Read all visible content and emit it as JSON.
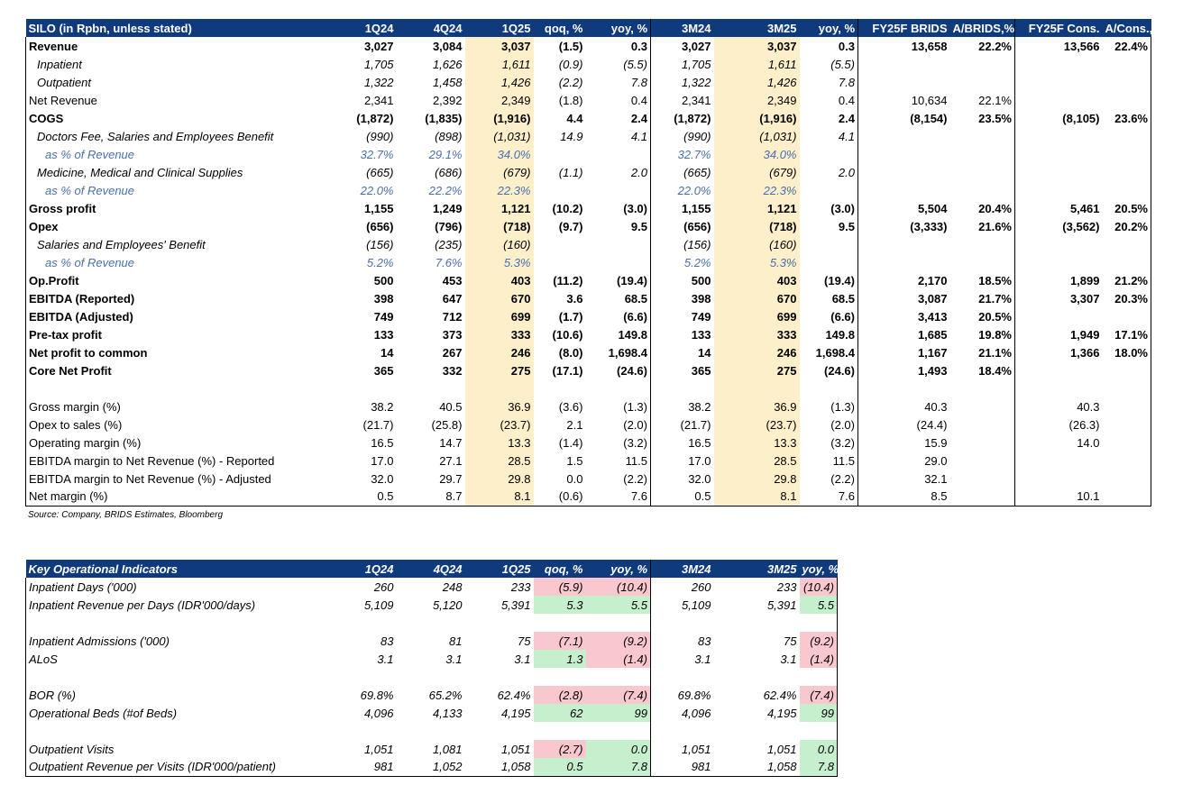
{
  "financials": {
    "header": [
      "SILO (in Rpbn, unless stated)",
      "1Q24",
      "4Q24",
      "1Q25",
      "qoq, %",
      "yoy, %",
      "3M24",
      "3M25",
      "yoy, %",
      "FY25F BRIDS",
      "A/BRIDS,%",
      "FY25F Cons.",
      "A/Cons.,%"
    ],
    "rows": [
      {
        "s": "b",
        "c": [
          "Revenue",
          "3,027",
          "3,084",
          "3,037",
          "(1.5)",
          "0.3",
          "3,027",
          "3,037",
          "0.3",
          "13,658",
          "22.2%",
          "13,566",
          "22.4%"
        ]
      },
      {
        "s": "i",
        "c": [
          "Inpatient",
          "1,705",
          "1,626",
          "1,611",
          "(0.9)",
          "(5.5)",
          "1,705",
          "1,611",
          "(5.5)",
          "",
          "",
          "",
          ""
        ]
      },
      {
        "s": "i",
        "c": [
          "Outpatient",
          "1,322",
          "1,458",
          "1,426",
          "(2.2)",
          "7.8",
          "1,322",
          "1,426",
          "7.8",
          "",
          "",
          "",
          ""
        ]
      },
      {
        "s": "ni",
        "c": [
          "Net Revenue",
          "2,341",
          "2,392",
          "2,349",
          "(1.8)",
          "0.4",
          "2,341",
          "2,349",
          "0.4",
          "10,634",
          "22.1%",
          "",
          ""
        ]
      },
      {
        "s": "b",
        "c": [
          "COGS",
          "(1,872)",
          "(1,835)",
          "(1,916)",
          "4.4",
          "2.4",
          "(1,872)",
          "(1,916)",
          "2.4",
          "(8,154)",
          "23.5%",
          "(8,105)",
          "23.6%"
        ]
      },
      {
        "s": "i",
        "c": [
          "Doctors Fee, Salaries and Employees Benefit",
          "(990)",
          "(898)",
          "(1,031)",
          "14.9",
          "4.1",
          "(990)",
          "(1,031)",
          "4.1",
          "",
          "",
          "",
          ""
        ]
      },
      {
        "s": "p",
        "c": [
          "as % of Revenue",
          "32.7%",
          "29.1%",
          "34.0%",
          "",
          "",
          "32.7%",
          "34.0%",
          "",
          "",
          "",
          "",
          ""
        ]
      },
      {
        "s": "i",
        "c": [
          "Medicine, Medical and Clinical Supplies",
          "(665)",
          "(686)",
          "(679)",
          "(1.1)",
          "2.0",
          "(665)",
          "(679)",
          "2.0",
          "",
          "",
          "",
          ""
        ]
      },
      {
        "s": "p",
        "c": [
          "as % of Revenue",
          "22.0%",
          "22.2%",
          "22.3%",
          "",
          "",
          "22.0%",
          "22.3%",
          "",
          "",
          "",
          "",
          ""
        ]
      },
      {
        "s": "b",
        "c": [
          "Gross profit",
          "1,155",
          "1,249",
          "1,121",
          "(10.2)",
          "(3.0)",
          "1,155",
          "1,121",
          "(3.0)",
          "5,504",
          "20.4%",
          "5,461",
          "20.5%"
        ]
      },
      {
        "s": "b",
        "c": [
          "Opex",
          "(656)",
          "(796)",
          "(718)",
          "(9.7)",
          "9.5",
          "(656)",
          "(718)",
          "9.5",
          "(3,333)",
          "21.6%",
          "(3,562)",
          "20.2%"
        ]
      },
      {
        "s": "i",
        "c": [
          "Salaries and Employees' Benefit",
          "(156)",
          "(235)",
          "(160)",
          "",
          "",
          "(156)",
          "(160)",
          "",
          "",
          "",
          "",
          ""
        ]
      },
      {
        "s": "p",
        "c": [
          "as % of Revenue",
          "5.2%",
          "7.6%",
          "5.3%",
          "",
          "",
          "5.2%",
          "5.3%",
          "",
          "",
          "",
          "",
          ""
        ]
      },
      {
        "s": "b",
        "c": [
          "Op.Profit",
          "500",
          "453",
          "403",
          "(11.2)",
          "(19.4)",
          "500",
          "403",
          "(19.4)",
          "2,170",
          "18.5%",
          "1,899",
          "21.2%"
        ]
      },
      {
        "s": "b",
        "c": [
          "EBITDA (Reported)",
          "398",
          "647",
          "670",
          "3.6",
          "68.5",
          "398",
          "670",
          "68.5",
          "3,087",
          "21.7%",
          "3,307",
          "20.3%"
        ]
      },
      {
        "s": "b",
        "c": [
          "EBITDA (Adjusted)",
          "749",
          "712",
          "699",
          "(1.7)",
          "(6.6)",
          "749",
          "699",
          "(6.6)",
          "3,413",
          "20.5%",
          "",
          ""
        ]
      },
      {
        "s": "b",
        "c": [
          "Pre-tax profit",
          "133",
          "373",
          "333",
          "(10.6)",
          "149.8",
          "133",
          "333",
          "149.8",
          "1,685",
          "19.8%",
          "1,949",
          "17.1%"
        ]
      },
      {
        "s": "b",
        "c": [
          "Net profit to common",
          "14",
          "267",
          "246",
          "(8.0)",
          "1,698.4",
          "14",
          "246",
          "1,698.4",
          "1,167",
          "21.1%",
          "1,366",
          "18.0%"
        ]
      },
      {
        "s": "b",
        "c": [
          "Core Net Profit",
          "365",
          "332",
          "275",
          "(17.1)",
          "(24.6)",
          "365",
          "275",
          "(24.6)",
          "1,493",
          "18.4%",
          "",
          ""
        ]
      },
      {
        "s": "blank",
        "c": [
          "",
          "",
          "",
          "",
          "",
          "",
          "",
          "",
          "",
          "",
          "",
          "",
          ""
        ]
      },
      {
        "s": "n",
        "c": [
          "Gross margin (%)",
          "38.2",
          "40.5",
          "36.9",
          "(3.6)",
          "(1.3)",
          "38.2",
          "36.9",
          "(1.3)",
          "40.3",
          "",
          "40.3",
          ""
        ]
      },
      {
        "s": "n",
        "c": [
          "Opex to sales (%)",
          "(21.7)",
          "(25.8)",
          "(23.7)",
          "2.1",
          "(2.0)",
          "(21.7)",
          "(23.7)",
          "(2.0)",
          "(24.4)",
          "",
          "(26.3)",
          ""
        ]
      },
      {
        "s": "n",
        "c": [
          "Operating margin (%)",
          "16.5",
          "14.7",
          "13.3",
          "(1.4)",
          "(3.2)",
          "16.5",
          "13.3",
          "(3.2)",
          "15.9",
          "",
          "14.0",
          ""
        ]
      },
      {
        "s": "n",
        "c": [
          "EBITDA margin to Net Revenue (%) - Reported",
          "17.0",
          "27.1",
          "28.5",
          "1.5",
          "11.5",
          "17.0",
          "28.5",
          "11.5",
          "29.0",
          "",
          "",
          ""
        ]
      },
      {
        "s": "n",
        "c": [
          "EBITDA margin to Net Revenue (%) - Adjusted",
          "32.0",
          "29.7",
          "29.8",
          "0.0",
          "(2.2)",
          "32.0",
          "29.8",
          "(2.2)",
          "32.1",
          "",
          "",
          ""
        ]
      },
      {
        "s": "n",
        "c": [
          "Net margin (%)",
          "0.5",
          "8.7",
          "8.1",
          "(0.6)",
          "7.6",
          "0.5",
          "8.1",
          "7.6",
          "8.5",
          "",
          "10.1",
          ""
        ]
      }
    ],
    "source": "Source: Company, BRIDS Estimates, Bloomberg"
  },
  "operations": {
    "header": [
      "Key Operational Indicators",
      "1Q24",
      "4Q24",
      "1Q25",
      "qoq, %",
      "yoy, %",
      "3M24",
      "3M25",
      "yoy, %"
    ],
    "rows": [
      {
        "c": [
          "Inpatient Days ('000)",
          "260",
          "248",
          "233",
          "(5.9)",
          "(10.4)",
          "260",
          "233",
          "(10.4)"
        ],
        "h": [
          "",
          "",
          "",
          "",
          "rd",
          "rd",
          "",
          "",
          "rd"
        ]
      },
      {
        "c": [
          "Inpatient Revenue per Days (IDR'000/days)",
          "5,109",
          "5,120",
          "5,391",
          "5.3",
          "5.5",
          "5,109",
          "5,391",
          "5.5"
        ],
        "h": [
          "",
          "",
          "",
          "",
          "gr",
          "gr",
          "",
          "",
          "gr"
        ]
      },
      {
        "c": [
          "",
          "",
          "",
          "",
          "",
          "",
          "",
          "",
          ""
        ],
        "h": [
          "",
          "",
          "",
          "",
          "",
          "",
          "",
          "",
          ""
        ]
      },
      {
        "c": [
          "Inpatient Admissions ('000)",
          "83",
          "81",
          "75",
          "(7.1)",
          "(9.2)",
          "83",
          "75",
          "(9.2)"
        ],
        "h": [
          "",
          "",
          "",
          "",
          "rd",
          "rd",
          "",
          "",
          "rd"
        ]
      },
      {
        "c": [
          "ALoS",
          "3.1",
          "3.1",
          "3.1",
          "1.3",
          "(1.4)",
          "3.1",
          "3.1",
          "(1.4)"
        ],
        "h": [
          "",
          "",
          "",
          "",
          "gr",
          "rd",
          "",
          "",
          "rd"
        ]
      },
      {
        "c": [
          "",
          "",
          "",
          "",
          "",
          "",
          "",
          "",
          ""
        ],
        "h": [
          "",
          "",
          "",
          "",
          "",
          "",
          "",
          "",
          ""
        ]
      },
      {
        "c": [
          "BOR (%)",
          "69.8%",
          "65.2%",
          "62.4%",
          "(2.8)",
          "(7.4)",
          "69.8%",
          "62.4%",
          "(7.4)"
        ],
        "h": [
          "",
          "",
          "",
          "",
          "rd",
          "rd",
          "",
          "",
          "rd"
        ]
      },
      {
        "c": [
          "Operational Beds (#of Beds)",
          "4,096",
          "4,133",
          "4,195",
          "62",
          "99",
          "4,096",
          "4,195",
          "99"
        ],
        "h": [
          "",
          "",
          "",
          "",
          "gr",
          "gr",
          "",
          "",
          "gr"
        ]
      },
      {
        "c": [
          "",
          "",
          "",
          "",
          "",
          "",
          "",
          "",
          ""
        ],
        "h": [
          "",
          "",
          "",
          "",
          "",
          "",
          "",
          "",
          ""
        ]
      },
      {
        "c": [
          "Outpatient Visits",
          "1,051",
          "1,081",
          "1,051",
          "(2.7)",
          "0.0",
          "1,051",
          "1,051",
          "0.0"
        ],
        "h": [
          "",
          "",
          "",
          "",
          "rd",
          "gr",
          "",
          "",
          "gr"
        ]
      },
      {
        "c": [
          "Outpatient Revenue per Visits (IDR'000/patient)",
          "981",
          "1,052",
          "1,058",
          "0.5",
          "7.8",
          "981",
          "1,058",
          "7.8"
        ],
        "h": [
          "",
          "",
          "",
          "",
          "gr",
          "gr",
          "",
          "",
          "gr"
        ]
      }
    ]
  }
}
